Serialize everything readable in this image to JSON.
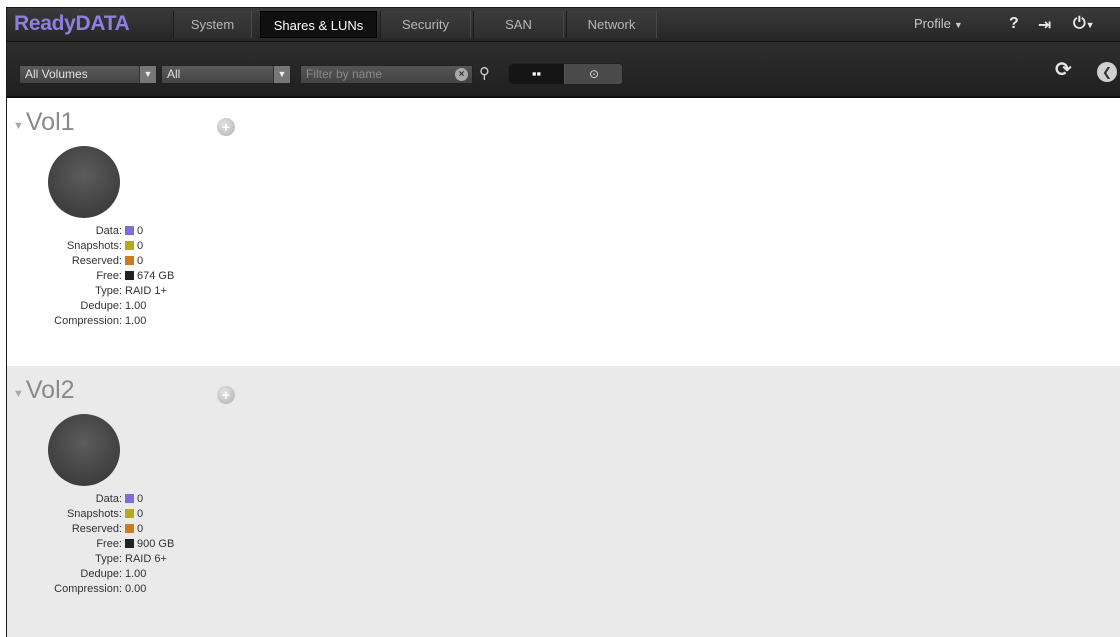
{
  "app": {
    "logo": "ReadyDATA"
  },
  "nav": {
    "tabs": [
      {
        "label": "System"
      },
      {
        "label": "Shares & LUNs",
        "active": true
      },
      {
        "label": "Security"
      },
      {
        "label": "SAN"
      },
      {
        "label": "Network"
      }
    ],
    "profile": "Profile",
    "icons": [
      "help-icon",
      "logout-icon",
      "power-icon"
    ]
  },
  "toolbar": {
    "volume_select": "All Volumes",
    "type_select": "All",
    "filter_placeholder": "Filter by name",
    "icons": [
      "clear-icon",
      "search-icon",
      "grid-view-icon",
      "alt-view-icon",
      "refresh-icon",
      "back-icon"
    ]
  },
  "colors": {
    "data": "#7b6fe0",
    "snapshots": "#b8a820",
    "reserved": "#d27a1e",
    "free": "#222222",
    "logo": "#8e7fe0"
  },
  "volumes": [
    {
      "name": "Vol1",
      "stats": {
        "data_label": "Data:",
        "data": "0",
        "snapshots_label": "Snapshots:",
        "snapshots": "0",
        "reserved_label": "Reserved:",
        "reserved": "0",
        "free_label": "Free:",
        "free": "674 GB",
        "type_label": "Type:",
        "type": "RAID 1+",
        "dedupe_label": "Dedupe:",
        "dedupe": "1.00",
        "compression_label": "Compression:",
        "compression": "1.00"
      }
    },
    {
      "name": "Vol2",
      "stats": {
        "data_label": "Data:",
        "data": "0",
        "snapshots_label": "Snapshots:",
        "snapshots": "0",
        "reserved_label": "Reserved:",
        "reserved": "0",
        "free_label": "Free:",
        "free": "900 GB",
        "type_label": "Type:",
        "type": "RAID 6+",
        "dedupe_label": "Dedupe:",
        "dedupe": "1.00",
        "compression_label": "Compression:",
        "compression": "0.00"
      }
    }
  ]
}
